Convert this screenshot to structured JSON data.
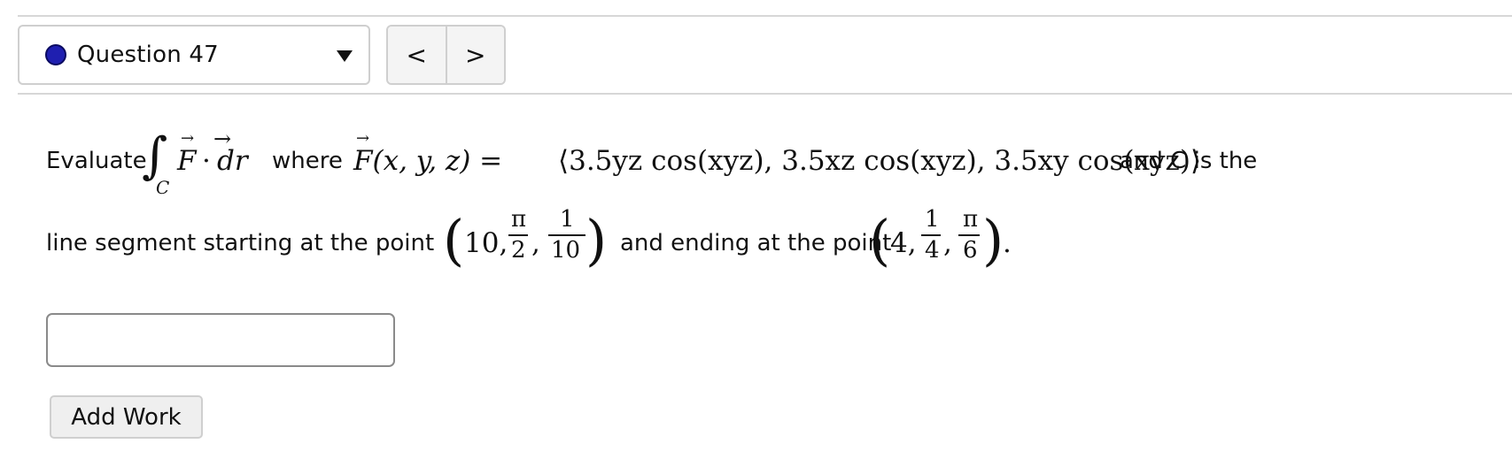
{
  "question": {
    "label": "Question 47",
    "status_color": "#1f1fb0"
  },
  "nav": {
    "prev_icon": "chevron-left-icon",
    "prev_glyph": "<",
    "next_icon": "chevron-right-icon",
    "next_glyph": ">"
  },
  "problem": {
    "evaluate": "Evaluate",
    "integral_sign": "∫",
    "integral_sub": "C",
    "integrand_F": "F",
    "dot": "·",
    "dr": "dr",
    "where": "where",
    "F_def_lhs": "F(x, y, z) =",
    "F_def_rhs": "⟨3.5yz cos(xyz), 3.5xz cos(xyz), 3.5xy cos(xyz)⟩",
    "and_c": "and C is the",
    "segment_text": "line segment starting at the point",
    "start_point": {
      "a": "10,",
      "b_num": "π",
      "b_den": "2",
      "c_num": "1",
      "c_den": "10"
    },
    "ending_text": "and ending at the point",
    "end_point": {
      "a": "4,",
      "b_num": "1",
      "b_den": "4",
      "c_num": "π",
      "c_den": "6"
    },
    "period": "."
  },
  "answer_input": {
    "value": "",
    "placeholder": ""
  },
  "add_work_label": "Add Work"
}
